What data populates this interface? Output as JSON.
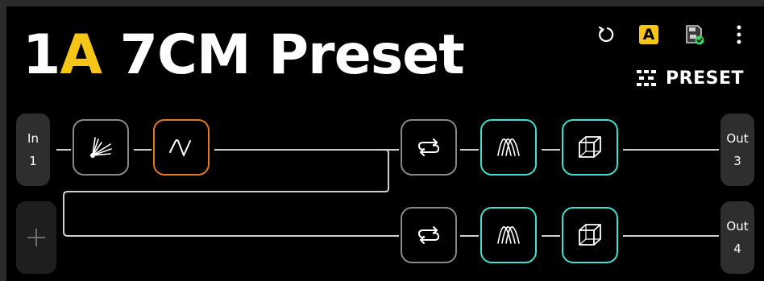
{
  "header": {
    "preset_number": "1",
    "preset_bank": "A",
    "preset_name": "7CM Preset",
    "bank_badge": "A",
    "view_label": "PRESET"
  },
  "colors": {
    "bank": "#f5c518",
    "selected_block": "#e8781e",
    "dual_block": "#3ee0d0",
    "mono_block": "#8a8a8a",
    "save_ok": "#3fcf5a"
  },
  "routing": {
    "input": {
      "label": "In",
      "number": "1"
    },
    "output_a": {
      "label": "Out",
      "number": "3"
    },
    "output_b": {
      "label": "Out",
      "number": "4"
    },
    "path_a_blocks": [
      {
        "icon": "gate-icon",
        "selected": false
      },
      {
        "icon": "filter-icon",
        "selected": true
      },
      {
        "icon": "loop-icon",
        "selected": false
      },
      {
        "icon": "reverb-wave-icon",
        "selected": false
      },
      {
        "icon": "cab-icon",
        "selected": false
      }
    ],
    "path_b_blocks": [
      {
        "icon": "loop-icon",
        "selected": false
      },
      {
        "icon": "reverb-wave-icon",
        "selected": false
      },
      {
        "icon": "cab-icon",
        "selected": false
      }
    ]
  }
}
